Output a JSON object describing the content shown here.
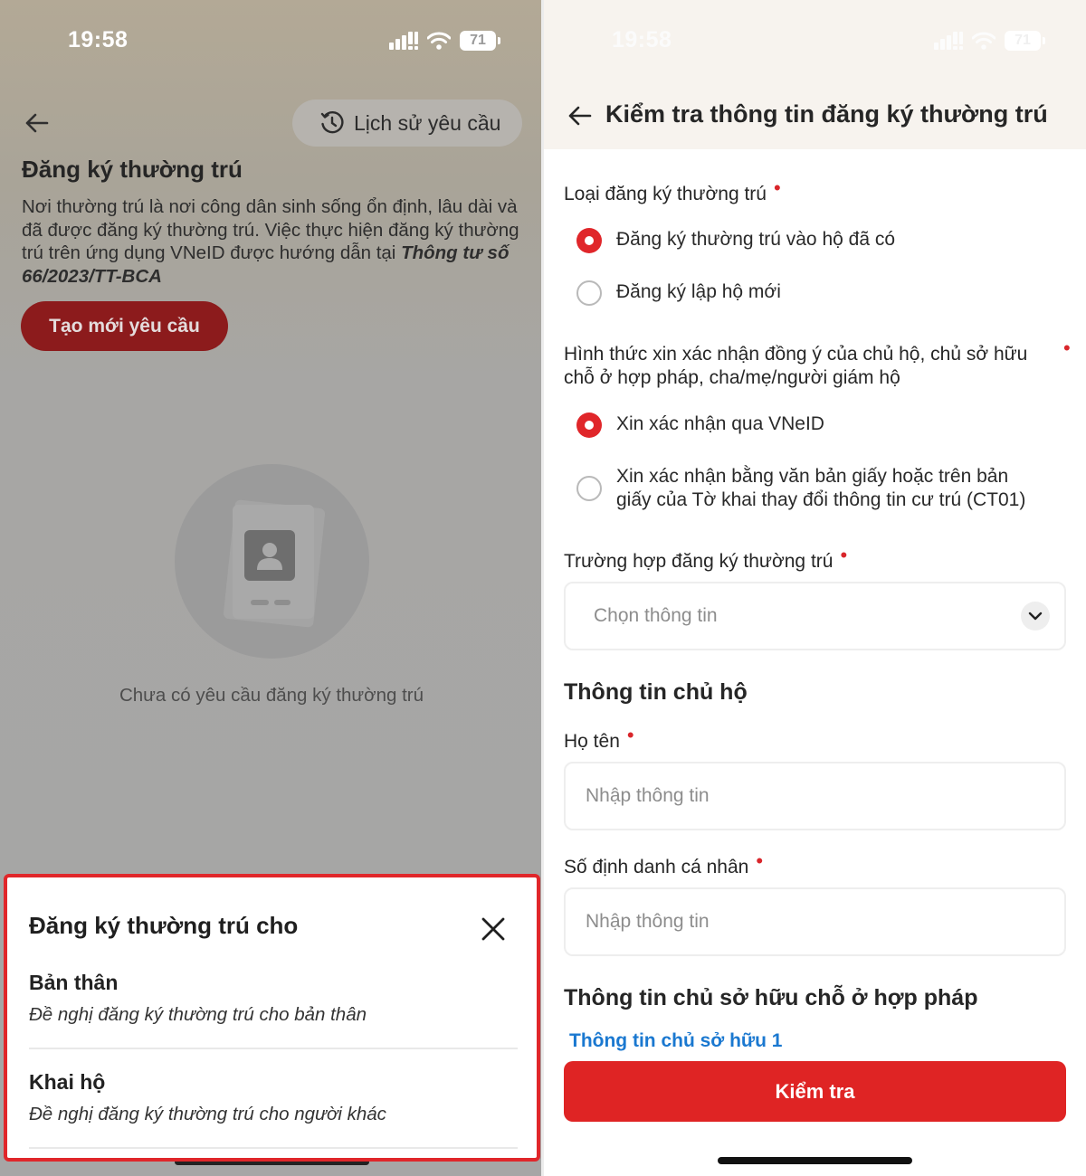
{
  "left_screen": {
    "status_bar": {
      "time": "19:58",
      "battery": "71"
    },
    "header": {
      "back_icon": "arrow-left-icon",
      "history_button": "Lịch sử yêu cầu",
      "history_icon": "clock-history-icon"
    },
    "title": "Đăng ký thường trú",
    "description": "Nơi thường trú là nơi công dân sinh sống ổn định, lâu dài và đã được đăng ký thường trú. Việc thực hiện đăng ký thường trú trên ứng dụng VNeID được hướng dẫn tại",
    "description_ref": "Thông tư số 66/2023/TT-BCA",
    "create_button": "Tạo mới yêu cầu",
    "empty_state": {
      "icon": "document-person-icon",
      "text": "Chưa có yêu cầu đăng ký thường trú"
    },
    "bottom_sheet": {
      "title": "Đăng ký thường trú cho",
      "close_icon": "close-icon",
      "options": [
        {
          "title": "Bản thân",
          "subtitle": "Đề nghị đăng ký thường trú cho bản thân"
        },
        {
          "title": "Khai hộ",
          "subtitle": "Đề nghị đăng ký thường trú cho người khác"
        }
      ]
    }
  },
  "right_screen": {
    "status_bar": {
      "time": "19:58",
      "battery": "71"
    },
    "header": {
      "back_icon": "arrow-left-icon",
      "title": "Kiểm tra thông tin đăng ký thường trú"
    },
    "required_mark": "•",
    "registration_type": {
      "label": "Loại đăng ký thường trú",
      "options": [
        {
          "label": "Đăng ký thường trú vào hộ đã có",
          "selected": true
        },
        {
          "label": "Đăng ký lập hộ mới",
          "selected": false
        }
      ]
    },
    "consent_method": {
      "label": "Hình thức xin xác nhận đồng ý của chủ hộ, chủ sở hữu chỗ ở hợp pháp, cha/mẹ/người giám hộ",
      "options": [
        {
          "label": "Xin xác nhận qua VNeID",
          "selected": true
        },
        {
          "label": "Xin xác nhận bằng văn bản giấy hoặc trên bản giấy của Tờ khai thay đổi thông tin cư trú (CT01)",
          "selected": false
        }
      ]
    },
    "case": {
      "label": "Trường hợp đăng ký thường trú",
      "placeholder": "Chọn thông tin",
      "chevron_icon": "chevron-down-icon"
    },
    "household_head": {
      "section_title": "Thông tin chủ hộ",
      "name_label": "Họ tên",
      "name_placeholder": "Nhập thông tin",
      "id_label": "Số định danh cá nhân",
      "id_placeholder": "Nhập thông tin"
    },
    "owner_section": {
      "title": "Thông tin chủ sở hữu chỗ ở hợp pháp",
      "owner_link": "Thông tin chủ sở hữu 1"
    },
    "submit_button": "Kiểm tra"
  },
  "colors": {
    "accent_red": "#df2424",
    "dark_red_dimmed": "#8c1b1c",
    "link_blue": "#1a78d0",
    "highlight_border": "#e0262a"
  }
}
